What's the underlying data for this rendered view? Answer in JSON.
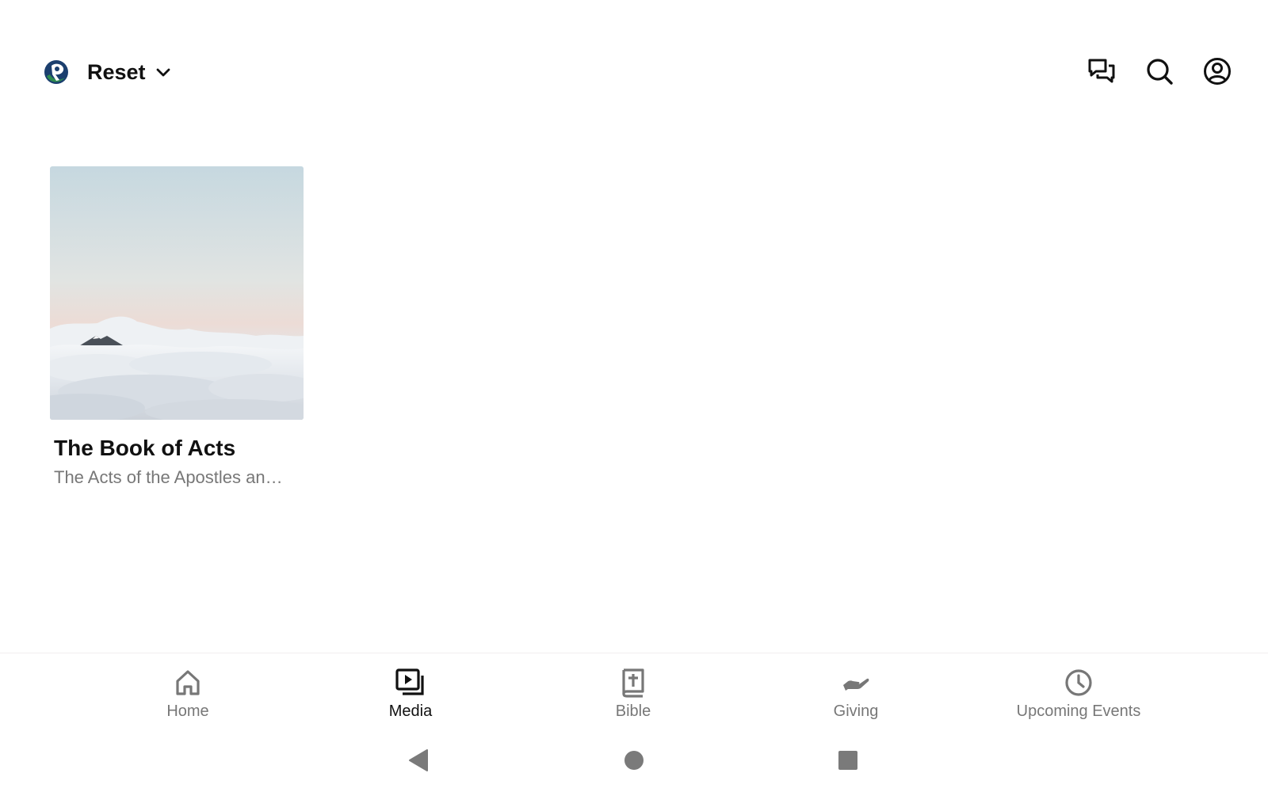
{
  "header": {
    "org_name": "Reset",
    "logo_icon": "church-logo-icon",
    "actions": [
      {
        "name": "chat-icon"
      },
      {
        "name": "search-icon"
      },
      {
        "name": "account-icon"
      }
    ]
  },
  "content": {
    "cards": [
      {
        "title": "The Book of Acts",
        "subtitle": "The Acts of the Apostles an…",
        "image": "sky-clouds-mountain-image"
      }
    ]
  },
  "tabs": [
    {
      "label": "Home",
      "icon": "home-icon",
      "active": false
    },
    {
      "label": "Media",
      "icon": "media-icon",
      "active": true
    },
    {
      "label": "Bible",
      "icon": "bible-icon",
      "active": false
    },
    {
      "label": "Giving",
      "icon": "giving-hand-icon",
      "active": false
    },
    {
      "label": "Upcoming Events",
      "icon": "clock-icon",
      "active": false
    }
  ],
  "system_nav": [
    {
      "name": "back-icon"
    },
    {
      "name": "home-circle-icon"
    },
    {
      "name": "recents-icon"
    }
  ],
  "colors": {
    "active_tab": "#111111",
    "inactive_tab": "#777777",
    "system_nav": "#7a7a7a"
  }
}
